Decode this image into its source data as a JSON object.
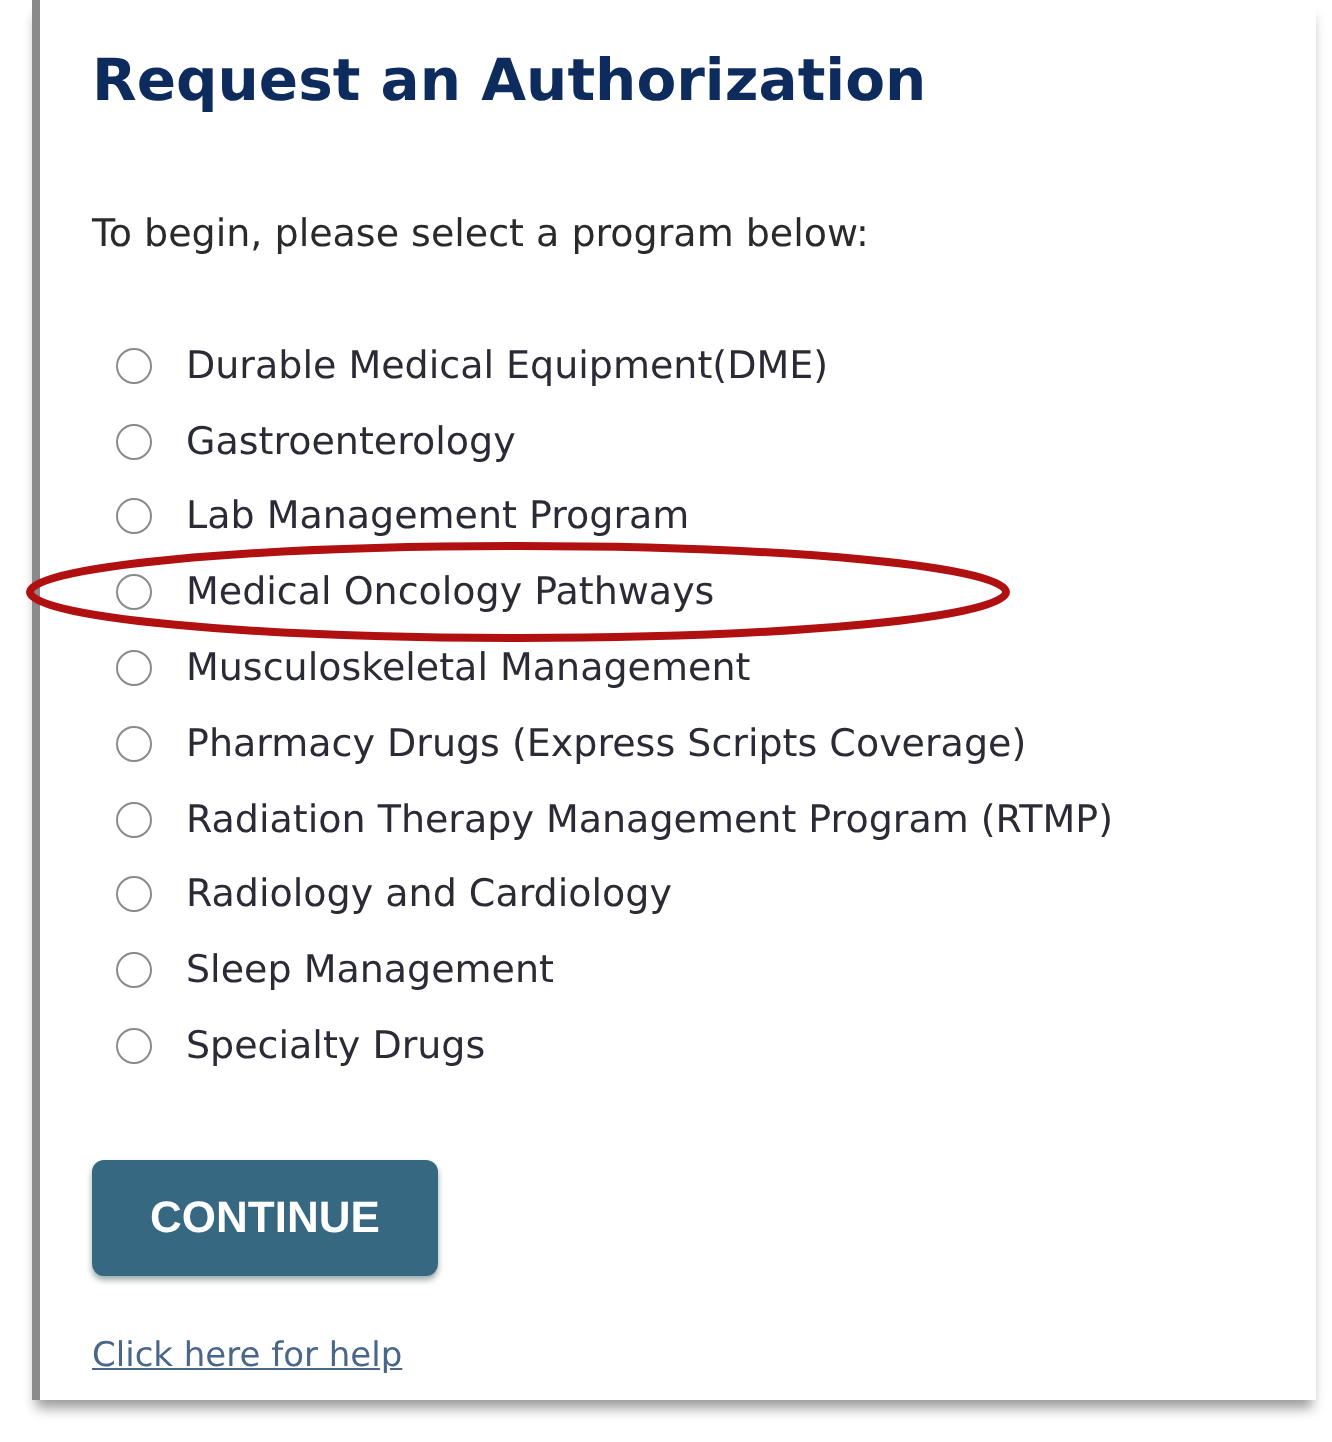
{
  "title": "Request an Authorization",
  "intro": "To begin, please select a program below:",
  "options": [
    {
      "label": "Durable Medical Equipment(DME)",
      "selected": false,
      "circled": false
    },
    {
      "label": "Gastroenterology",
      "selected": false,
      "circled": false
    },
    {
      "label": "Lab Management Program",
      "selected": false,
      "circled": false
    },
    {
      "label": "Medical Oncology Pathways",
      "selected": false,
      "circled": true
    },
    {
      "label": "Musculoskeletal Management",
      "selected": false,
      "circled": false
    },
    {
      "label": "Pharmacy Drugs (Express Scripts Coverage)",
      "selected": false,
      "circled": false
    },
    {
      "label": "Radiation Therapy Management Program (RTMP)",
      "selected": false,
      "circled": false
    },
    {
      "label": "Radiology and Cardiology",
      "selected": false,
      "circled": false
    },
    {
      "label": "Sleep Management",
      "selected": false,
      "circled": false
    },
    {
      "label": "Specialty Drugs",
      "selected": false,
      "circled": false
    }
  ],
  "continue_button": "CONTINUE",
  "help_link": "Click here for help"
}
